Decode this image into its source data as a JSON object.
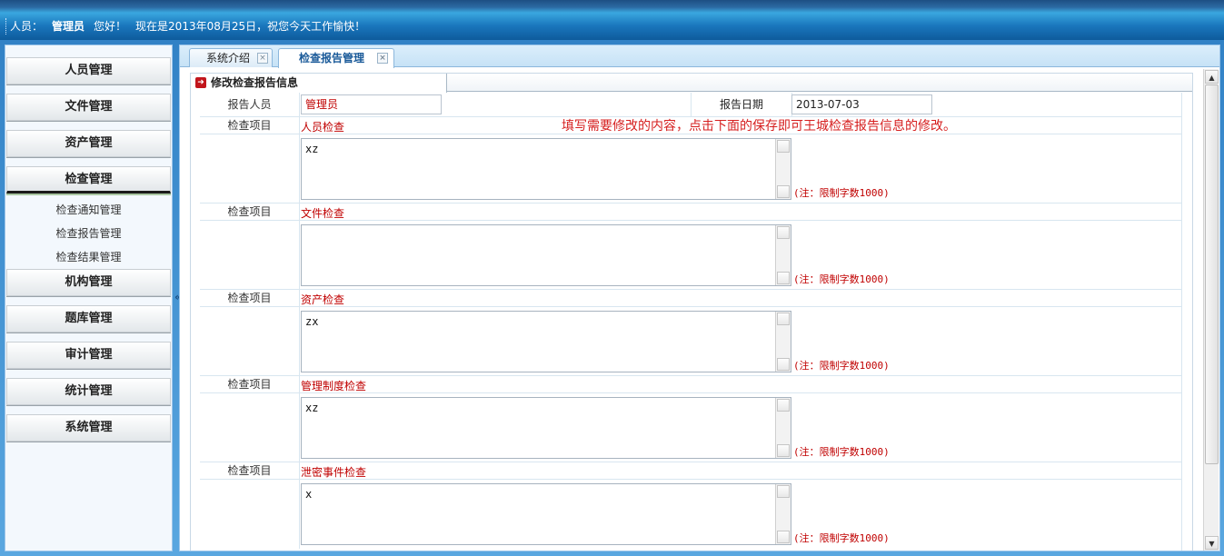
{
  "header": {
    "user_label": "人员：",
    "user_name": "管理员",
    "greeting": "您好！",
    "date_text": "现在是2013年08月25日，祝您今天工作愉快！"
  },
  "sidebar": {
    "items": [
      {
        "label": "人员管理"
      },
      {
        "label": "文件管理"
      },
      {
        "label": "资产管理"
      },
      {
        "label": "检查管理"
      },
      {
        "label": "机构管理"
      },
      {
        "label": "题库管理"
      },
      {
        "label": "审计管理"
      },
      {
        "label": "统计管理"
      },
      {
        "label": "系统管理"
      }
    ],
    "sub_items": [
      {
        "label": "检查通知管理"
      },
      {
        "label": "检查报告管理"
      },
      {
        "label": "检查结果管理"
      }
    ],
    "collapse_symbol": "«"
  },
  "tabs": [
    {
      "label": "系统介绍",
      "close": "×"
    },
    {
      "label": "检查报告管理",
      "close": "×"
    }
  ],
  "panel": {
    "title": "修改检查报告信息"
  },
  "form": {
    "reporter_label": "报告人员",
    "reporter_value": "管理员",
    "date_label": "报告日期",
    "date_value": "2013-07-03",
    "hint": "填写需要修改的内容，点击下面的保存即可王城检查报告信息的修改。",
    "item_label": "检查项目",
    "note": "(注：限制字数1000)",
    "items": [
      {
        "name": "人员检查",
        "content": "xz"
      },
      {
        "name": "文件检查",
        "content": ""
      },
      {
        "name": "资产检查",
        "content": "zx"
      },
      {
        "name": "管理制度检查",
        "content": "xz"
      },
      {
        "name": "泄密事件检查",
        "content": "x"
      }
    ]
  }
}
